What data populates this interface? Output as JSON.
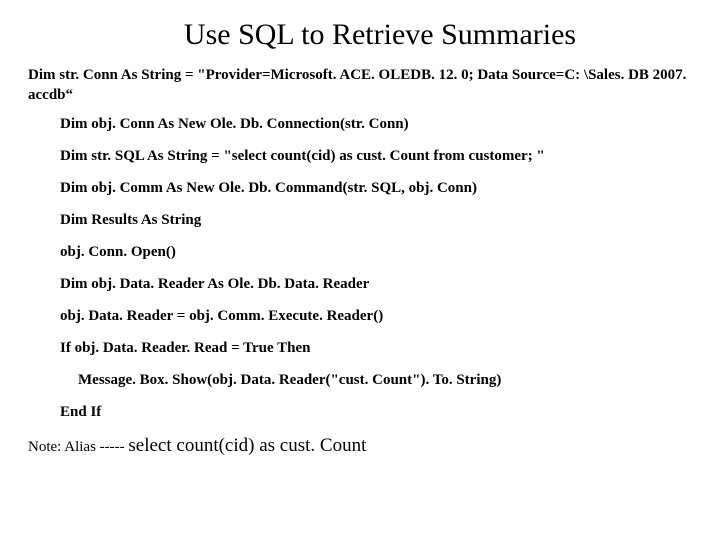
{
  "title": "Use SQL to Retrieve Summaries",
  "intro": "Dim str. Conn As String = \"Provider=Microsoft. ACE. OLEDB. 12. 0; Data Source=C: \\Sales. DB 2007. accdb“",
  "code": {
    "l1": "Dim obj. Conn As New Ole. Db. Connection(str. Conn)",
    "l2": "Dim str. SQL As String = \"select count(cid) as cust. Count from customer; \"",
    "l3": "Dim obj. Comm As New Ole. Db. Command(str. SQL, obj. Conn)",
    "l4": "Dim Results As String",
    "l5": "obj. Conn. Open()",
    "l6": "Dim obj. Data. Reader As Ole. Db. Data. Reader",
    "l7": "obj. Data. Reader = obj. Comm. Execute. Reader()",
    "l8": "If obj. Data. Reader. Read = True Then",
    "l9": "Message. Box. Show(obj. Data. Reader(\"cust. Count\"). To. String)",
    "l10": "End If"
  },
  "note": {
    "label": "Note: Alias ----- ",
    "code": "select count(cid) as cust. Count"
  }
}
